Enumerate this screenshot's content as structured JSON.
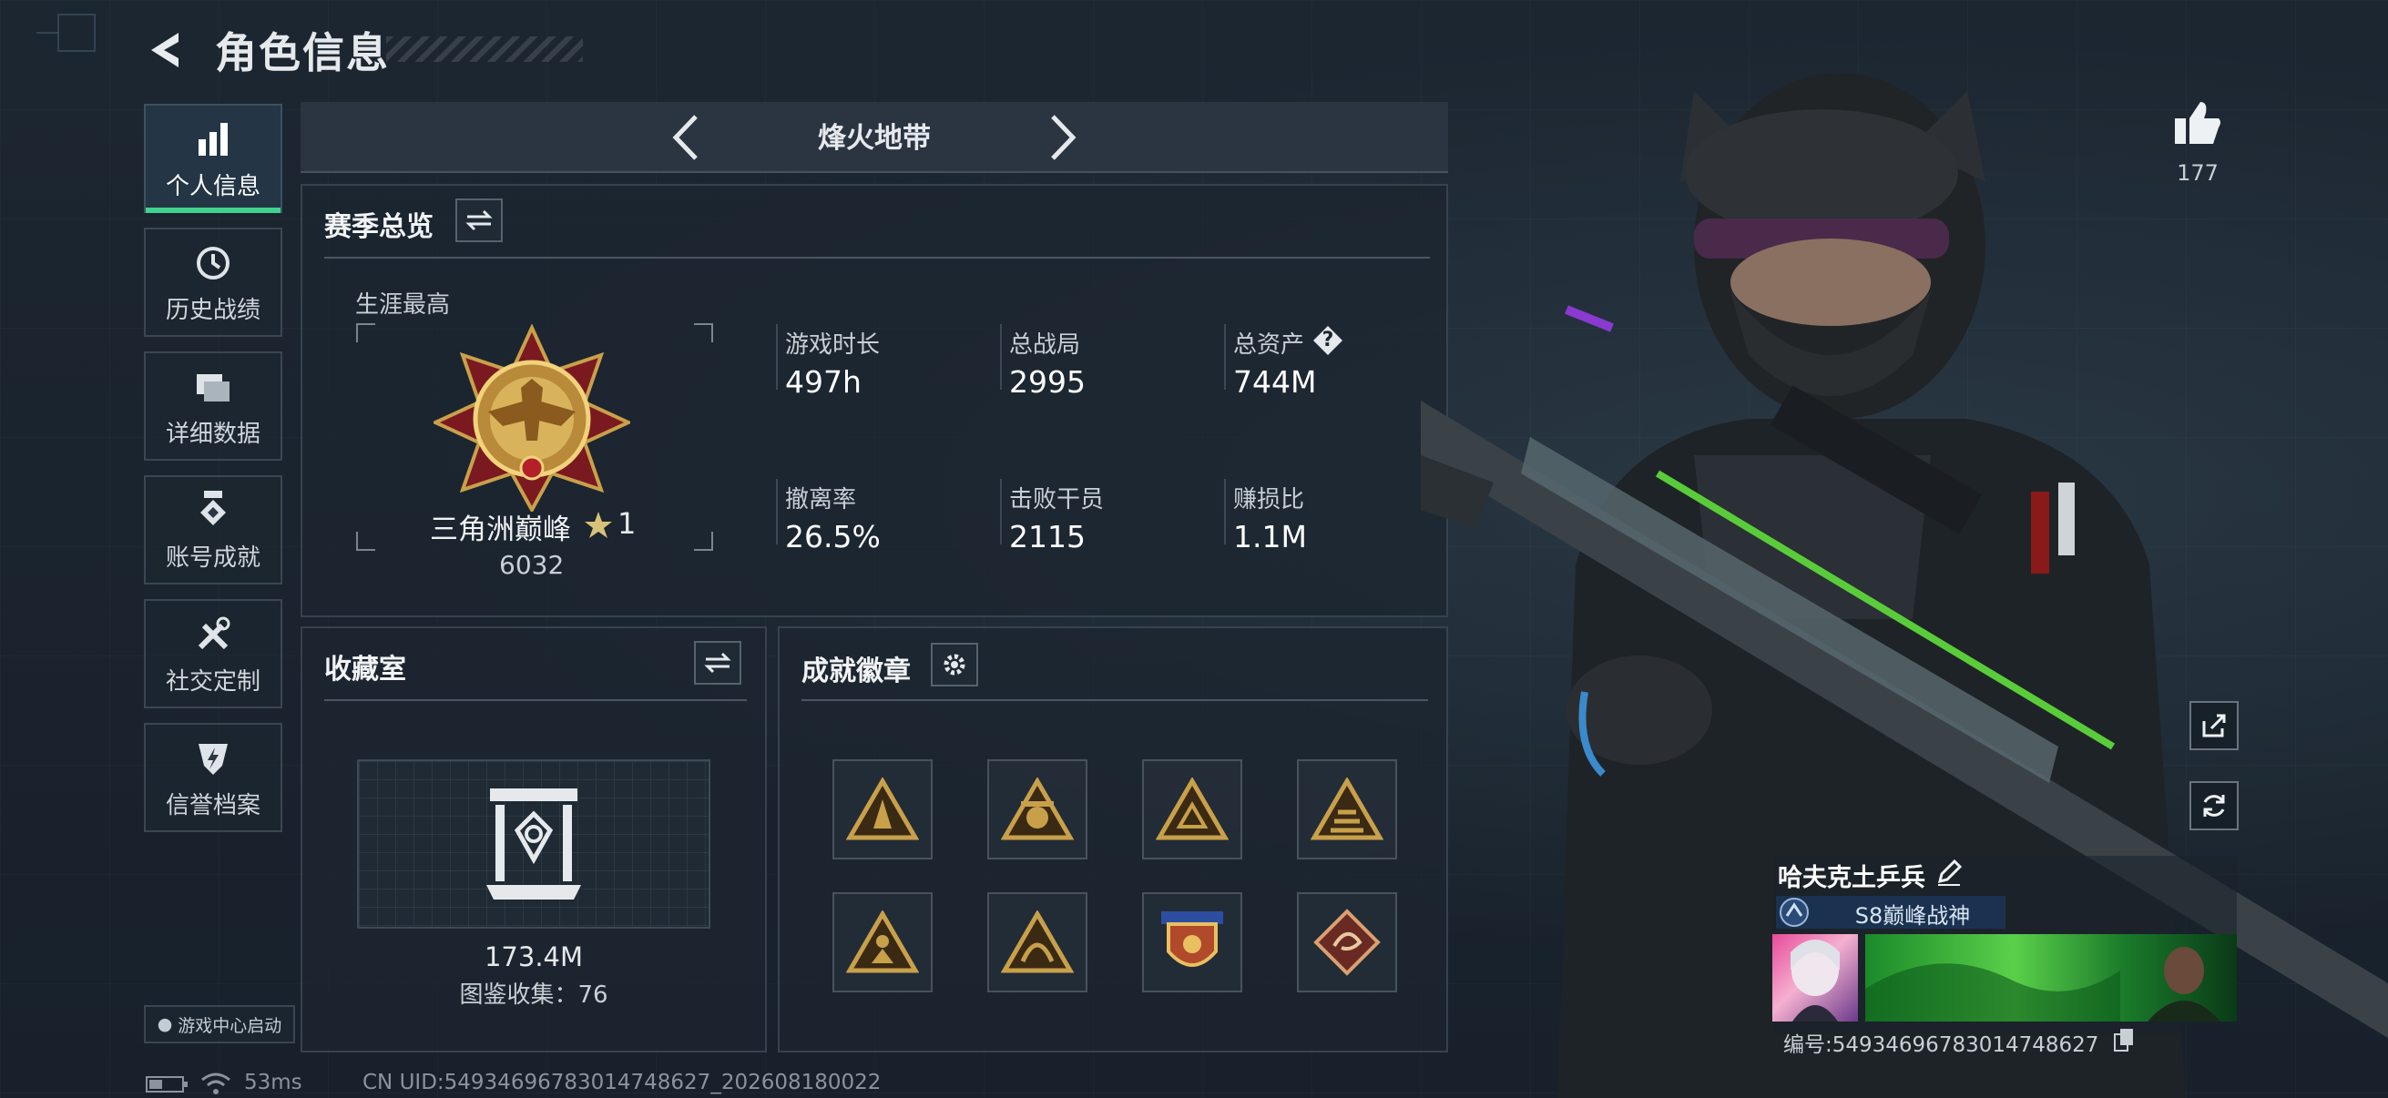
{
  "header": {
    "title": "角色信息"
  },
  "sidebar": {
    "items": [
      {
        "label": "个人信息",
        "icon": "bar-chart-icon",
        "active": true
      },
      {
        "label": "历史战绩",
        "icon": "history-icon"
      },
      {
        "label": "详细数据",
        "icon": "folder-icon"
      },
      {
        "label": "账号成就",
        "icon": "achievement-icon"
      },
      {
        "label": "社交定制",
        "icon": "tools-icon"
      },
      {
        "label": "信誉档案",
        "icon": "reputation-icon"
      }
    ],
    "launch_label": "游戏中心启动"
  },
  "mode_bar": {
    "title": "烽火地带"
  },
  "season": {
    "title": "赛季总览",
    "career_label": "生涯最高",
    "rank_name": "三角洲巅峰",
    "rank_stars": "1",
    "rank_score": "6032",
    "stats": [
      {
        "label": "游戏时长",
        "value": "497h"
      },
      {
        "label": "总战局",
        "value": "2995"
      },
      {
        "label": "总资产",
        "value": "744M",
        "help": "?"
      },
      {
        "label": "撤离率",
        "value": "26.5%"
      },
      {
        "label": "击败干员",
        "value": "2115"
      },
      {
        "label": "赚损比",
        "value": "1.1M"
      }
    ]
  },
  "collection": {
    "title": "收藏室",
    "value": "173.4M",
    "collect_text": "图鉴收集：76"
  },
  "achievements": {
    "title": "成就徽章",
    "badges": [
      "badge-1",
      "badge-2",
      "badge-3",
      "badge-4",
      "badge-5",
      "badge-6",
      "badge-7",
      "badge-8"
    ]
  },
  "right": {
    "like_count": "177",
    "player_name": "哈夫克土乒兵",
    "title_badge": "S8巅峰战神",
    "uid_line": "编号:5493469678301474862‌7"
  },
  "status_bar": {
    "ping": "53ms",
    "cn_uid": "CN UID:5493469678301474862‌7_202608180022"
  },
  "colors": {
    "accent": "#3fd38e",
    "gold": "#c9a04a",
    "panel": "#1c2630"
  }
}
